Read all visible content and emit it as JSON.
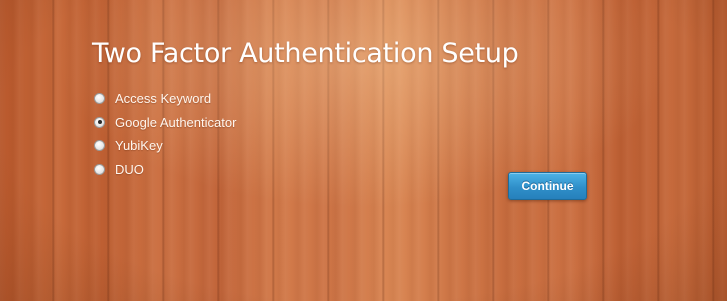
{
  "page": {
    "title": "Two Factor Authentication Setup"
  },
  "options": [
    {
      "label": "Access Keyword",
      "checked": false
    },
    {
      "label": "Google Authenticator",
      "checked": true
    },
    {
      "label": "YubiKey",
      "checked": false
    },
    {
      "label": "DUO",
      "checked": false
    }
  ],
  "actions": {
    "continue_label": "Continue"
  },
  "colors": {
    "button": "#2f8fc9",
    "title_text": "#ffffff",
    "background_wood": "#c7693a"
  }
}
